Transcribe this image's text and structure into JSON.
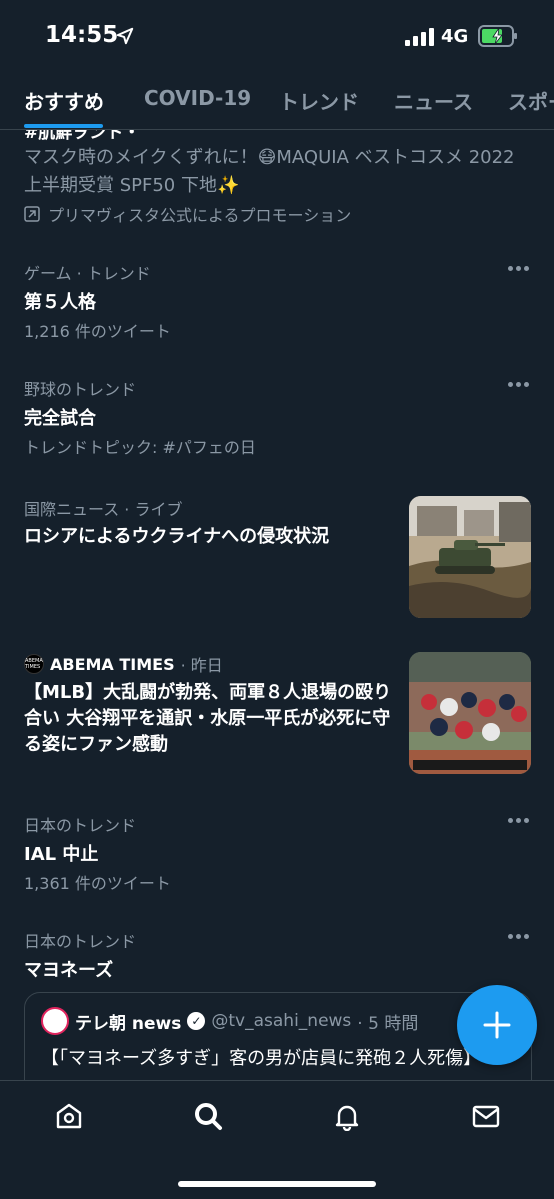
{
  "status_bar": {
    "time": "14:55",
    "network": "4G"
  },
  "tabs": [
    {
      "label": "おすすめ",
      "active": true
    },
    {
      "label": "COVID-19",
      "active": false
    },
    {
      "label": "トレンド",
      "active": false
    },
    {
      "label": "ニュース",
      "active": false
    },
    {
      "label": "スポー",
      "active": false
    }
  ],
  "promo": {
    "title_cutoff": "#肌鮮ヲント・",
    "description": "マスク時のメイクくずれに！😷MAQUIA ベストコスメ 2022 上半期受賞 SPF50 下地✨",
    "promoted_by": "プリマヴィスタ公式によるプロモーション"
  },
  "trends": [
    {
      "category": "ゲーム · トレンド",
      "name": "第５人格",
      "meta": "1,216 件のツイート"
    },
    {
      "category": "野球のトレンド",
      "name": "完全試合",
      "meta": "トレンドトピック: #パフェの日"
    }
  ],
  "news": [
    {
      "category": "国際ニュース · ライブ",
      "title": "ロシアによるウクライナへの侵攻状況"
    },
    {
      "source": "ABEMA TIMES",
      "time": "· 昨日",
      "logo_text": "ABEMA TIMES",
      "title": "【MLB】大乱闘が勃発、両軍８人退場の殴り合い 大谷翔平を通訳・水原一平氏が必死に守る姿にファン感動"
    }
  ],
  "trends_jp": [
    {
      "category": "日本のトレンド",
      "name": "IAL 中止",
      "meta": "1,361 件のツイート"
    },
    {
      "category": "日本のトレンド",
      "name": "マヨネーズ"
    }
  ],
  "embedded_tweet": {
    "name": "テレ朝 news",
    "handle": "@tv_asahi_news",
    "time": "· 5 時間",
    "text": "【「マヨネーズ多すぎ」客の男が店員に発砲２人死傷】"
  },
  "colors": {
    "background": "#15202b",
    "accent": "#1d9bf0",
    "secondary_text": "#8b98a5",
    "divider": "#38444d"
  },
  "icons": [
    "location-arrow-icon",
    "signal-icon",
    "battery-charging-icon",
    "promoted-icon",
    "more-icon",
    "verified-icon",
    "compose-icon",
    "home-icon",
    "search-icon",
    "bell-icon",
    "mail-icon"
  ]
}
